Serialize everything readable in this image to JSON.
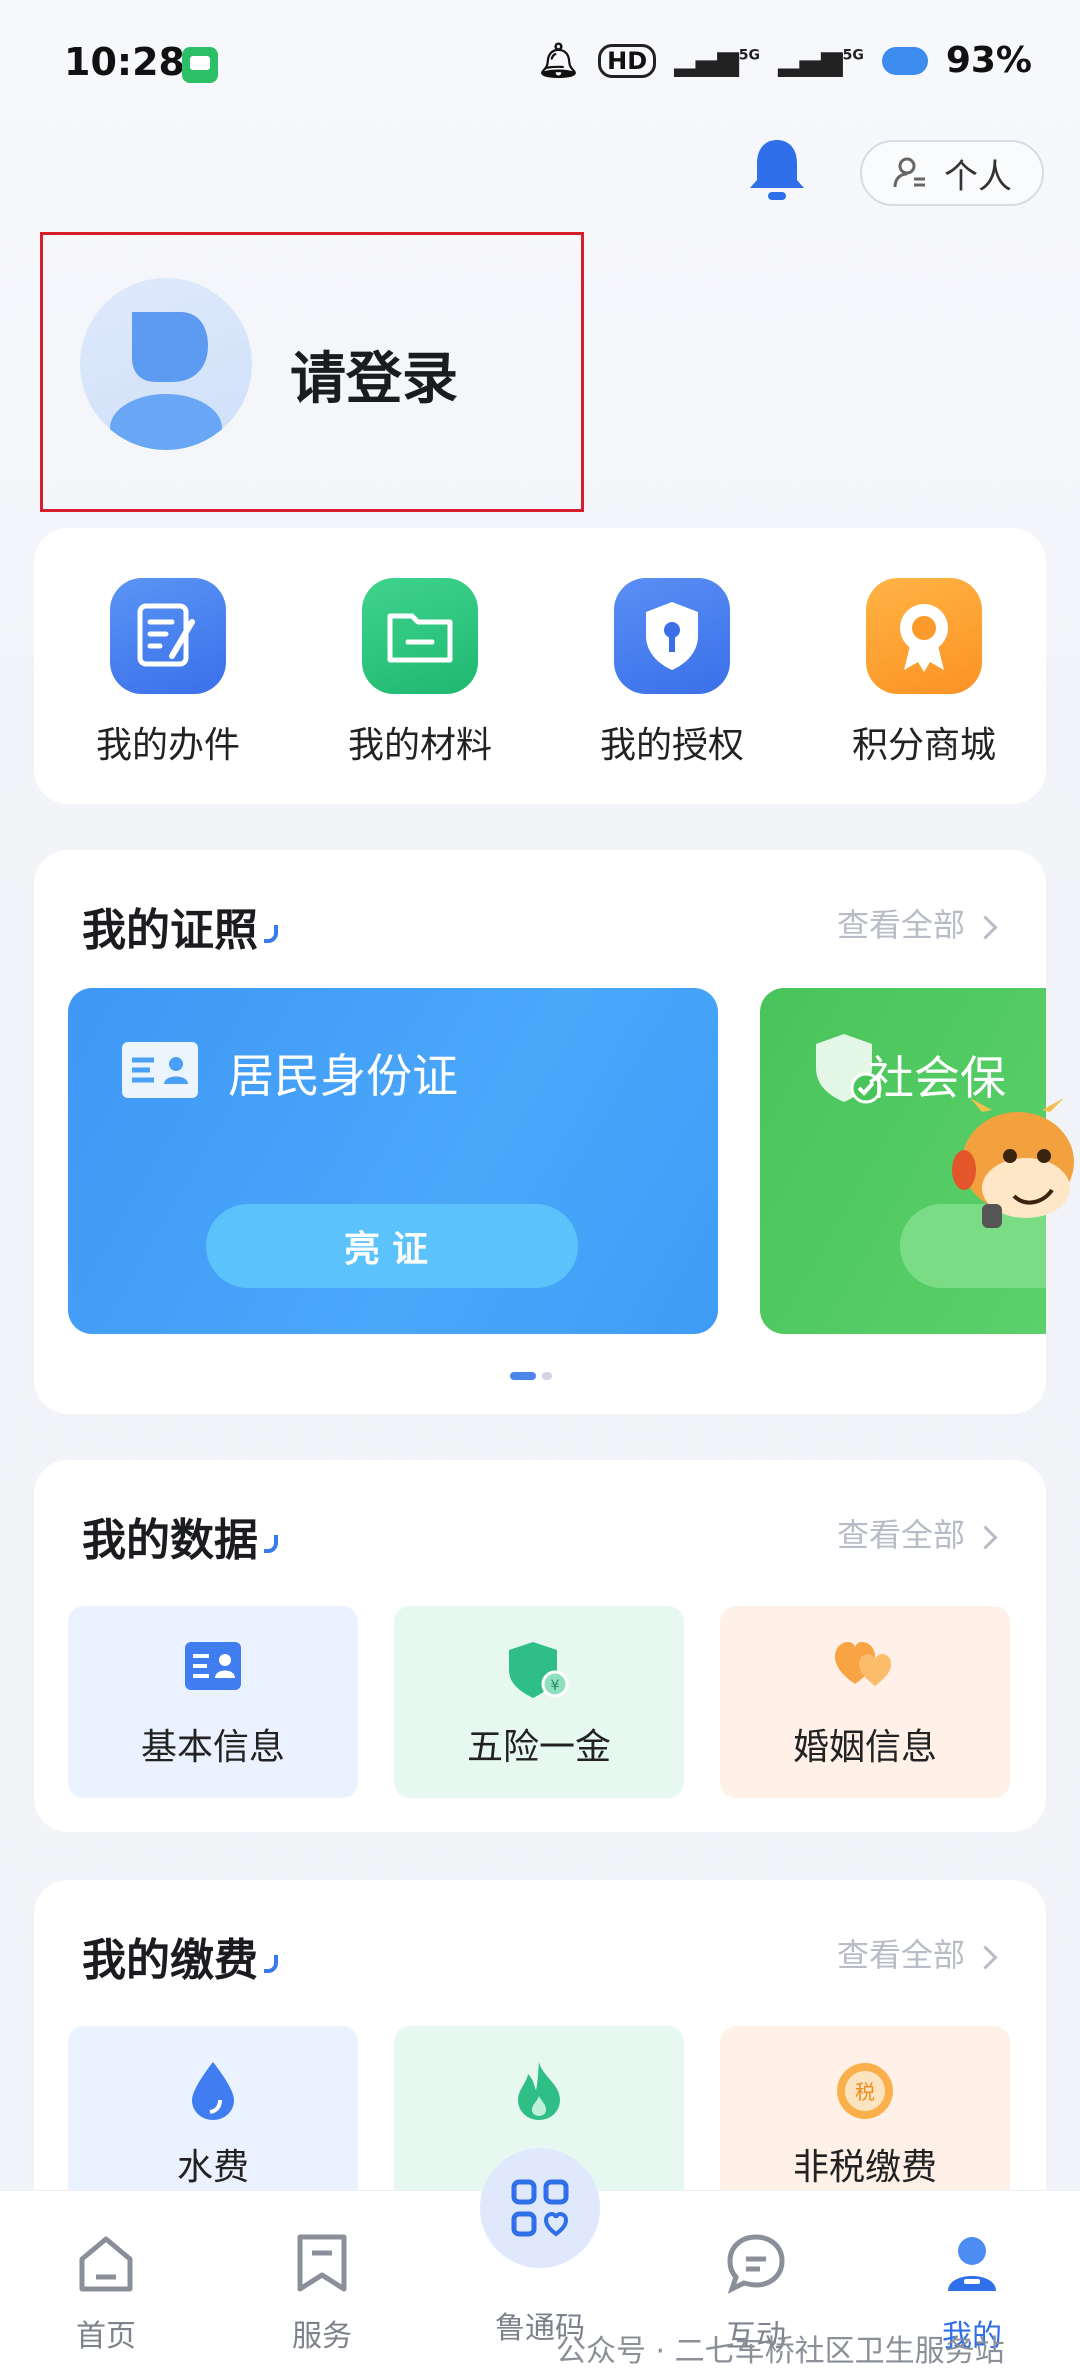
{
  "status_bar": {
    "time": "10:28",
    "battery": "93%",
    "signal_1": "5G",
    "signal_2": "5G",
    "hd": "HD"
  },
  "header": {
    "personal_label": "个人"
  },
  "profile": {
    "login_text": "请登录"
  },
  "quick_actions": [
    {
      "label": "我的办件",
      "icon": "edit-document-icon",
      "color": "#3d7cf0"
    },
    {
      "label": "我的材料",
      "icon": "folder-icon",
      "color": "#23c27b"
    },
    {
      "label": "我的授权",
      "icon": "key-shield-icon",
      "color": "#3f7af0"
    },
    {
      "label": "积分商城",
      "icon": "award-ribbon-icon",
      "color": "#fb9a2a"
    }
  ],
  "certificates": {
    "title": "我的证照",
    "see_all": "查看全部",
    "cards": [
      {
        "title": "居民身份证",
        "button": "亮证",
        "icon": "id-card-icon"
      },
      {
        "title": "社会保",
        "icon": "social-security-icon"
      }
    ]
  },
  "my_data": {
    "title": "我的数据",
    "see_all": "查看全部",
    "items": [
      {
        "label": "基本信息",
        "icon": "id-card-icon"
      },
      {
        "label": "五险一金",
        "icon": "insurance-shield-icon"
      },
      {
        "label": "婚姻信息",
        "icon": "hearts-icon"
      }
    ]
  },
  "my_payments": {
    "title": "我的缴费",
    "see_all": "查看全部",
    "items": [
      {
        "label": "水费",
        "icon": "water-drop-icon"
      },
      {
        "label": "",
        "icon": "flame-icon"
      },
      {
        "label": "非税缴费",
        "icon": "tax-coin-icon"
      }
    ]
  },
  "bottom_nav": [
    {
      "label": "首页",
      "icon": "home-icon"
    },
    {
      "label": "服务",
      "icon": "bookmark-icon"
    },
    {
      "label": "鲁通码",
      "icon": "qr-grid-icon"
    },
    {
      "label": "互动",
      "icon": "chat-bubble-icon"
    },
    {
      "label": "我的",
      "icon": "profile-icon",
      "active": true
    }
  ],
  "watermark": "公众号 · 二七车桥社区卫生服务站",
  "colors": {
    "accent": "#3a7bea",
    "highlight_border": "#d71f2b"
  }
}
